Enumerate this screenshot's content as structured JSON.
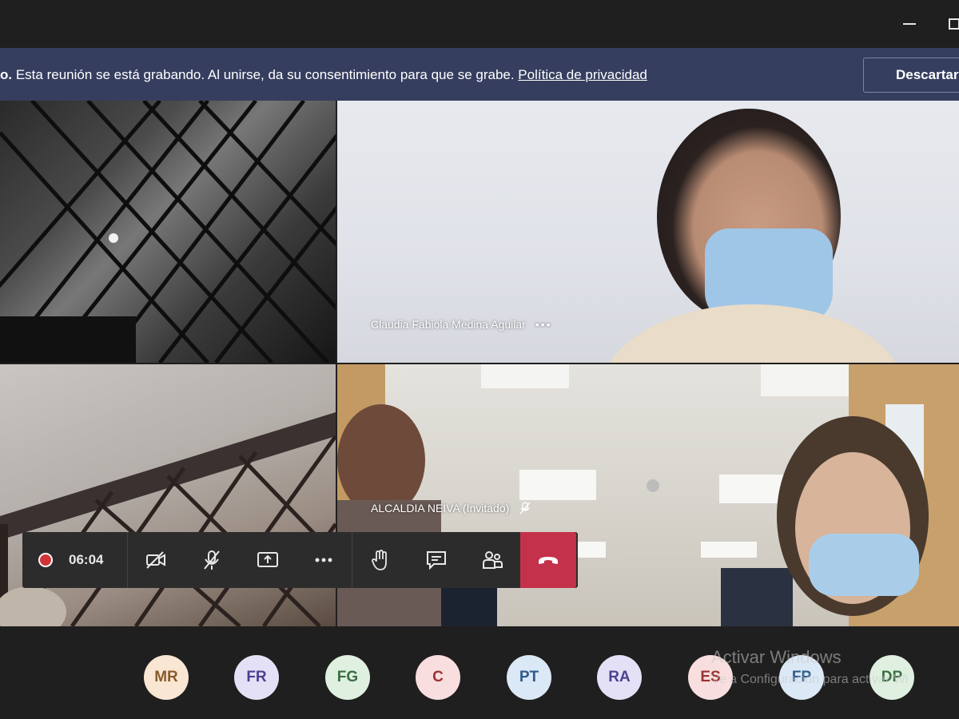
{
  "window": {
    "minimize_icon": "minimize-icon",
    "maximize_icon": "maximize-icon"
  },
  "banner": {
    "prefix": "o.",
    "message": " Esta reunión se está grabando. Al unirse, da su consentimiento para que se grabe. ",
    "privacy_link": "Política de privacidad",
    "dismiss_label": "Descartar"
  },
  "video_tiles": [
    {
      "name": ""
    },
    {
      "name": "Claudia Fabiola Medina Aguilar",
      "more": "•••"
    },
    {
      "name": ""
    },
    {
      "name": "ALCALDIA NEIVA (Invitado)",
      "muted_icon": "mic-muted-icon"
    }
  ],
  "controls": {
    "recording_time": "06:04",
    "icons": [
      "record-icon",
      "camera-off-icon",
      "mic-off-icon",
      "share-screen-icon",
      "more-options-icon",
      "raise-hand-icon",
      "chat-icon",
      "participants-icon",
      "hang-up-icon"
    ],
    "hangup_color": "#c4314b"
  },
  "participants": [
    {
      "initials": "MR",
      "bg": "#f9e7d3",
      "fg": "#8a5a2b"
    },
    {
      "initials": "FR",
      "bg": "#e4e1f7",
      "fg": "#4b4190"
    },
    {
      "initials": "FG",
      "bg": "#dff0e1",
      "fg": "#3b6e41"
    },
    {
      "initials": "C",
      "bg": "#f8dede",
      "fg": "#9a3232"
    },
    {
      "initials": "PT",
      "bg": "#dbe8f6",
      "fg": "#2e5b8a"
    },
    {
      "initials": "RA",
      "bg": "#e4e1f7",
      "fg": "#4b4190"
    },
    {
      "initials": "ES",
      "bg": "#f8dede",
      "fg": "#9a3232"
    },
    {
      "initials": "FP",
      "bg": "#dbe8f6",
      "fg": "#2e5b8a"
    },
    {
      "initials": "DP",
      "bg": "#dff0e1",
      "fg": "#3b6e41"
    }
  ],
  "watermark": {
    "line1": "Activar Windows",
    "line2": "Ve a Configuración para activar Wi"
  }
}
